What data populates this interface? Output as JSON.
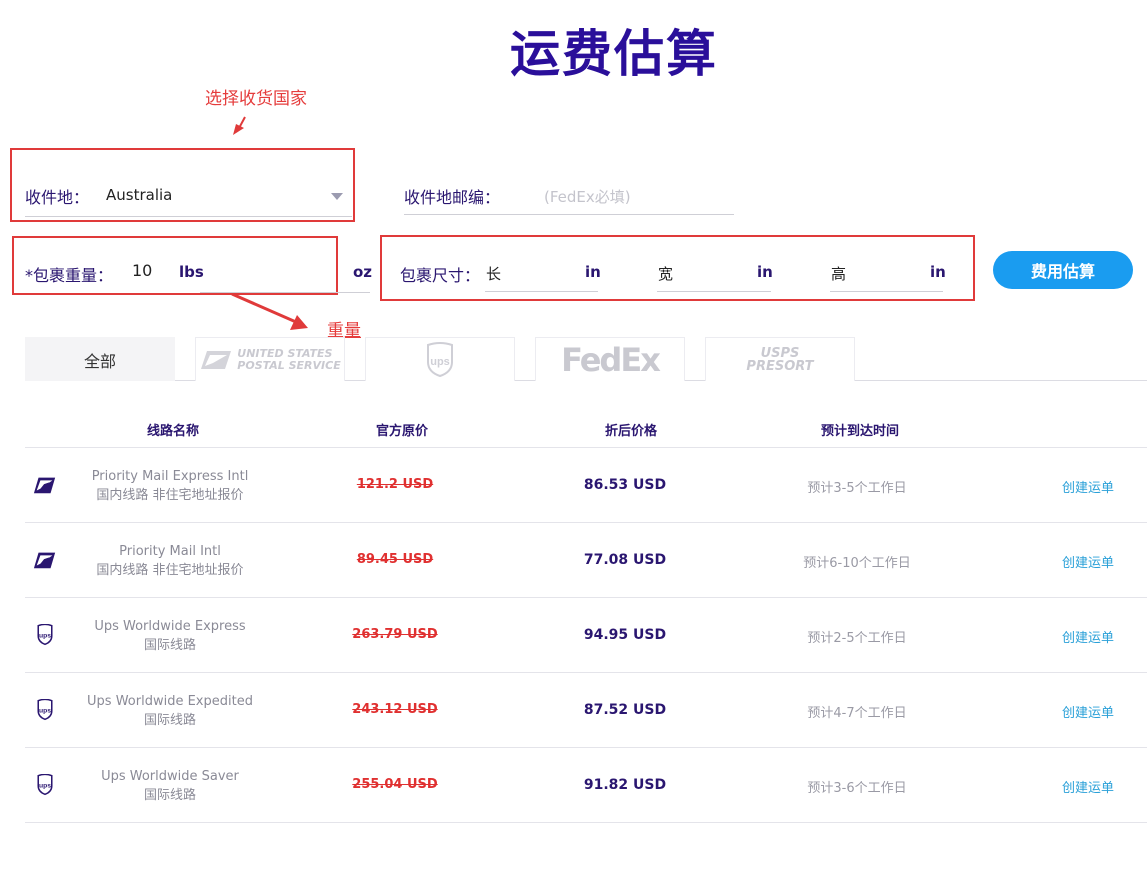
{
  "title": "运费估算",
  "annotations": {
    "country": "选择收货国家",
    "weight": "重量"
  },
  "form": {
    "destination_label": "收件地：",
    "destination_value": "Australia",
    "zip_label": "收件地邮编：",
    "zip_placeholder": "(FedEx必填)",
    "weight_label": "*包裹重量：",
    "weight_value": "10",
    "weight_unit_lbs": "lbs",
    "weight_unit_oz": "oz",
    "size_label": "包裹尺寸：",
    "length_label": "长",
    "width_label": "宽",
    "height_label": "高",
    "size_unit": "in",
    "estimate_button": "费用估算"
  },
  "tabs": {
    "all": "全部",
    "usps_line1": "UNITED STATES",
    "usps_line2": "POSTAL SERVICE",
    "ups": "ups",
    "fedex_a": "Fed",
    "fedex_b": "Ex",
    "presort_line1": "USPS",
    "presort_line2": "PRESORT"
  },
  "table": {
    "headers": {
      "route": "线路名称",
      "original": "官方原价",
      "discount": "折后价格",
      "eta": "预计到达时间"
    },
    "rows": [
      {
        "icon": "usps-eagle-icon",
        "name": "Priority Mail Express Intl",
        "sub": "国内线路 非住宅地址报价",
        "original": "121.2 USD",
        "discount": "86.53 USD",
        "eta": "预计3-5个工作日",
        "action": "创建运单"
      },
      {
        "icon": "usps-eagle-icon",
        "name": "Priority Mail Intl",
        "sub": "国内线路 非住宅地址报价",
        "original": "89.45 USD",
        "discount": "77.08 USD",
        "eta": "预计6-10个工作日",
        "action": "创建运单"
      },
      {
        "icon": "ups-shield-icon",
        "name": "Ups Worldwide Express",
        "sub": "国际线路",
        "original": "263.79 USD",
        "discount": "94.95 USD",
        "eta": "预计2-5个工作日",
        "action": "创建运单"
      },
      {
        "icon": "ups-shield-icon",
        "name": "Ups Worldwide Expedited",
        "sub": "国际线路",
        "original": "243.12 USD",
        "discount": "87.52 USD",
        "eta": "预计4-7个工作日",
        "action": "创建运单"
      },
      {
        "icon": "ups-shield-icon",
        "name": "Ups Worldwide Saver",
        "sub": "国际线路",
        "original": "255.04 USD",
        "discount": "91.82 USD",
        "eta": "预计3-6个工作日",
        "action": "创建运单"
      }
    ]
  },
  "colors": {
    "title": "#2a0f9a",
    "accent": "#1a9cf0",
    "annotation": "#e03a3a",
    "strike_price": "#e03030",
    "link": "#2aa0d8"
  }
}
